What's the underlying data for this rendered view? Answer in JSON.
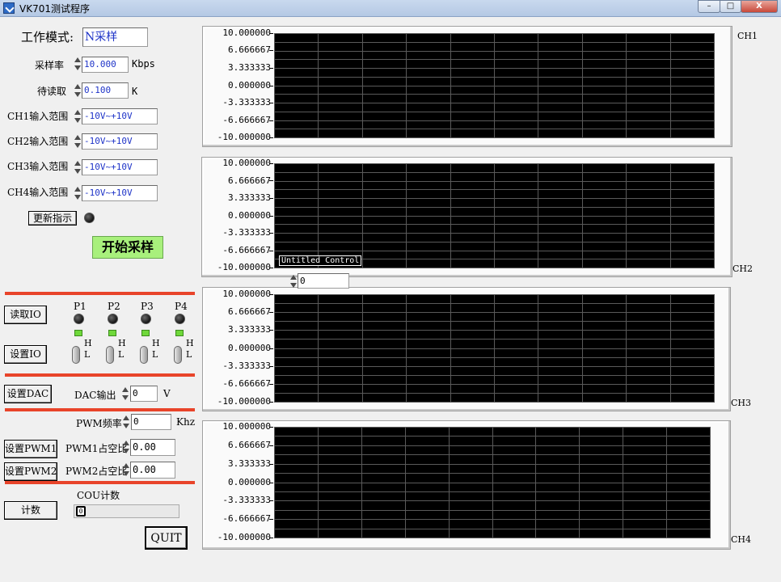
{
  "window": {
    "title": "VK701测试程序",
    "minimize": "–",
    "maximize": "□",
    "close": "X"
  },
  "settings": {
    "work_mode_label": "工作模式:",
    "work_mode_value": "N采样",
    "sample_rate_label": "采样率",
    "sample_rate_value": "10.000",
    "sample_rate_unit": "Kbps",
    "pending_read_label": "待读取",
    "pending_read_value": "0.100",
    "pending_read_unit": "K",
    "ch1_range_label": "CH1输入范围",
    "ch1_range_value": "-10V~+10V",
    "ch2_range_label": "CH2输入范围",
    "ch2_range_value": "-10V~+10V",
    "ch3_range_label": "CH3输入范围",
    "ch3_range_value": "-10V~+10V",
    "ch4_range_label": "CH4输入范围",
    "ch4_range_value": "-10V~+10V",
    "update_indicator_label": "更新指示",
    "start_button": "开始采样"
  },
  "io": {
    "read_button": "读取IO",
    "set_button": "设置IO",
    "ports": [
      "P1",
      "P2",
      "P3",
      "P4"
    ],
    "high_label": "H",
    "low_label": "L"
  },
  "dac": {
    "set_button": "设置DAC",
    "output_label": "DAC输出",
    "output_value": "0",
    "unit": "V"
  },
  "pwm": {
    "freq_label": "PWM频率",
    "freq_value": "0",
    "freq_unit": "Khz",
    "set1_button": "设置PWM1",
    "set2_button": "设置PWM2",
    "duty1_label": "PWM1占空比",
    "duty1_value": "0.00",
    "duty2_label": "PWM2占空比",
    "duty2_value": "0.00"
  },
  "counter": {
    "title": "COU计数",
    "button": "计数",
    "value": "0"
  },
  "quit_button": "QUIT",
  "untitled_control": {
    "label": "Untitled Control",
    "value": "0"
  },
  "charts": {
    "y_ticks": [
      "10.000000",
      "6.666667",
      "3.333333",
      "0.000000",
      "-3.333333",
      "-6.666667",
      "-10.000000"
    ],
    "ch1": "CH1",
    "ch2": "CH2",
    "ch3": "CH3",
    "ch4": "CH4"
  },
  "chart_data": [
    {
      "type": "line",
      "title": "",
      "channel": "CH1",
      "ylim": [
        -10,
        10
      ],
      "y_ticks": [
        10,
        6.666667,
        3.333333,
        0,
        -3.333333,
        -6.666667,
        -10
      ],
      "grid": true,
      "series": []
    },
    {
      "type": "line",
      "title": "",
      "channel": "CH2",
      "ylim": [
        -10,
        10
      ],
      "y_ticks": [
        10,
        6.666667,
        3.333333,
        0,
        -3.333333,
        -6.666667,
        -10
      ],
      "grid": true,
      "series": []
    },
    {
      "type": "line",
      "title": "",
      "channel": "CH3",
      "ylim": [
        -10,
        10
      ],
      "y_ticks": [
        10,
        6.666667,
        3.333333,
        0,
        -3.333333,
        -6.666667,
        -10
      ],
      "grid": true,
      "series": []
    },
    {
      "type": "line",
      "title": "",
      "channel": "CH4",
      "ylim": [
        -10,
        10
      ],
      "y_ticks": [
        10,
        6.666667,
        3.333333,
        0,
        -3.333333,
        -6.666667,
        -10
      ],
      "grid": true,
      "series": []
    }
  ]
}
